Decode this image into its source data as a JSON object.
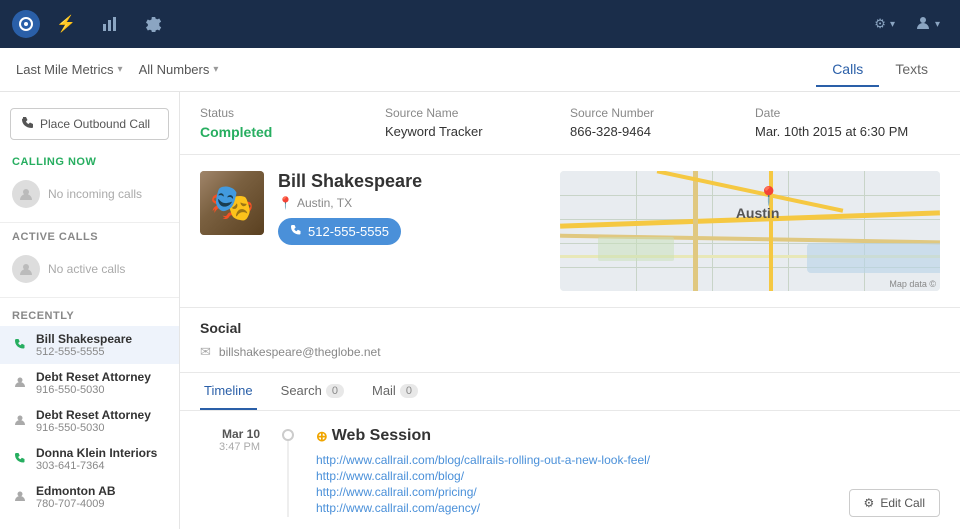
{
  "topnav": {
    "logo_symbol": "◉",
    "icons": [
      {
        "name": "lightning",
        "symbol": "⚡",
        "label": "activity-icon",
        "active": true
      },
      {
        "name": "bar-chart",
        "symbol": "▦",
        "label": "reports-icon",
        "active": false
      },
      {
        "name": "settings",
        "symbol": "⚙",
        "label": "settings-icon",
        "active": false
      }
    ],
    "right_icons": [
      {
        "name": "gear-dropdown",
        "symbol": "⚙",
        "label": "gear-dropdown-icon"
      },
      {
        "name": "user-dropdown",
        "symbol": "👤",
        "label": "user-dropdown-icon"
      }
    ]
  },
  "subnav": {
    "account_label": "Last Mile Metrics",
    "numbers_label": "All Numbers",
    "tabs": [
      {
        "id": "calls",
        "label": "Calls",
        "active": true
      },
      {
        "id": "texts",
        "label": "Texts",
        "active": false
      }
    ]
  },
  "sidebar": {
    "outbound_btn_label": "Place Outbound Call",
    "calling_now_label": "CALLING NOW",
    "no_incoming_label": "No incoming calls",
    "active_calls_label": "ACTIVE CALLS",
    "no_active_label": "No active calls",
    "recently_label": "RECENTLY",
    "recent_items": [
      {
        "name": "Bill Shakespeare",
        "phone": "512-555-5555",
        "icon": "phone",
        "active": true,
        "color": "green"
      },
      {
        "name": "Debt Reset Attorney",
        "phone": "916-550-5030",
        "icon": "user",
        "active": false,
        "color": "gray"
      },
      {
        "name": "Debt Reset Attorney",
        "phone": "916-550-5030",
        "icon": "user",
        "active": false,
        "color": "gray"
      },
      {
        "name": "Donna Klein Interiors",
        "phone": "303-641-7364",
        "icon": "phone",
        "active": false,
        "color": "green"
      },
      {
        "name": "Edmonton AB",
        "phone": "780-707-4009",
        "icon": "user",
        "active": false,
        "color": "gray"
      }
    ]
  },
  "call_header": {
    "status_label": "Status",
    "status_value": "Completed",
    "source_name_label": "Source Name",
    "source_name_value": "Keyword Tracker",
    "source_number_label": "Source Number",
    "source_number_value": "866-328-9464",
    "date_label": "Date",
    "date_value": "Mar. 10th 2015 at 6:30 PM"
  },
  "caller": {
    "name": "Bill Shakespeare",
    "location": "Austin, TX",
    "phone": "512-555-5555",
    "map_label": "Austin",
    "map_credit": "Map data ©"
  },
  "social": {
    "title": "Social",
    "email": "billshakespeare@theglobe.net"
  },
  "detail_tabs": [
    {
      "id": "timeline",
      "label": "Timeline",
      "count": null,
      "active": true
    },
    {
      "id": "search",
      "label": "Search",
      "count": "0",
      "active": false
    },
    {
      "id": "mail",
      "label": "Mail",
      "count": "0",
      "active": false
    }
  ],
  "timeline": {
    "date_month_day": "Mar 10",
    "time": "3:47 PM",
    "session_type": "Web Session",
    "links": [
      "http://www.callrail.com/blog/callrails-rolling-out-a-new-look-feel/",
      "http://www.callrail.com/blog/",
      "http://www.callrail.com/pricing/",
      "http://www.callrail.com/agency/"
    ]
  },
  "edit_call_btn": "Edit Call"
}
